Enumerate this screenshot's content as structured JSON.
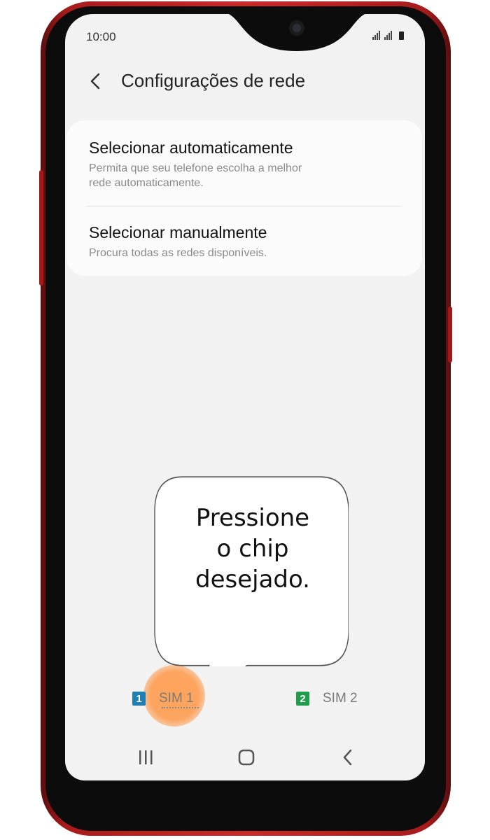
{
  "status_bar": {
    "time": "10:00"
  },
  "header": {
    "title": "Configurações de rede"
  },
  "options": [
    {
      "title": "Selecionar automaticamente",
      "subtitle_line1": "Permita que seu telefone escolha a melhor",
      "subtitle_line2": "rede automaticamente."
    },
    {
      "title": "Selecionar manualmente",
      "subtitle_line1": "Procura todas as redes disponíveis."
    }
  ],
  "callout": {
    "line1": "Pressione",
    "line2": "o chip",
    "line3": "desejado."
  },
  "sim_tabs": [
    {
      "number": "1",
      "label": "SIM 1",
      "selected": true,
      "color": "#1f7fb4"
    },
    {
      "number": "2",
      "label": "SIM 2",
      "selected": false,
      "color": "#1e9e4a"
    }
  ],
  "nav": {
    "icons": [
      "recent-apps-icon",
      "home-icon",
      "back-icon"
    ]
  },
  "colors": {
    "phone_body": "#c92a2a",
    "touch_highlight": "#ff9a4d"
  }
}
